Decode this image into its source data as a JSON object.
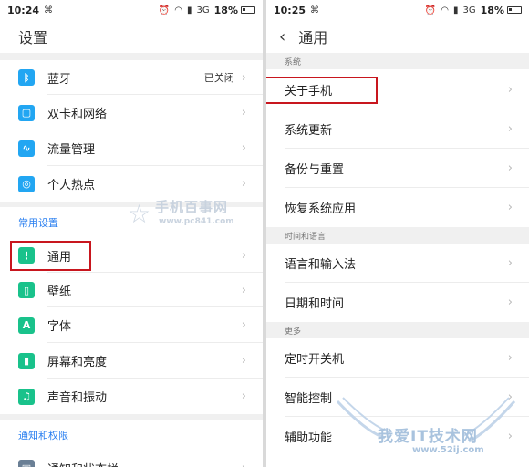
{
  "left": {
    "status": {
      "time": "10:24",
      "network": "3G",
      "battery": "18%"
    },
    "title": "设置",
    "top_items": [
      {
        "icon": "bluetooth-icon",
        "label": "蓝牙",
        "value": "已关闭"
      },
      {
        "icon": "sim-icon",
        "label": "双卡和网络"
      },
      {
        "icon": "data-usage-icon",
        "label": "流量管理"
      },
      {
        "icon": "hotspot-icon",
        "label": "个人热点"
      }
    ],
    "section_common": "常用设置",
    "common_items": [
      {
        "icon": "general-icon",
        "label": "通用"
      },
      {
        "icon": "wallpaper-icon",
        "label": "壁纸"
      },
      {
        "icon": "font-icon",
        "label": "字体"
      },
      {
        "icon": "brightness-icon",
        "label": "屏幕和亮度"
      },
      {
        "icon": "bell-icon",
        "label": "声音和振动"
      }
    ],
    "section_notify": "通知和权限",
    "notify_items": [
      {
        "icon": "notification-icon",
        "label": "通知和状态栏"
      }
    ]
  },
  "right": {
    "status": {
      "time": "10:25",
      "network": "3G",
      "battery": "18%"
    },
    "title": "通用",
    "section_system": "系统",
    "system_items": [
      "关于手机",
      "系统更新",
      "备份与重置",
      "恢复系统应用"
    ],
    "section_lang": "时间和语言",
    "lang_items": [
      "语言和输入法",
      "日期和时间"
    ],
    "section_more": "更多",
    "more_items": [
      "定时开关机",
      "智能控制",
      "辅助功能"
    ]
  },
  "watermarks": {
    "site1_title": "手机百事网",
    "site1_url": "www.pc841.com",
    "site2_title": "我爱IT技术网",
    "site2_url": "www.52ij.com"
  },
  "colors": {
    "accent_blue": "#2a7ff0",
    "icon_blue": "#22a6f2",
    "icon_green": "#19c28b",
    "highlight_red": "#c8161e"
  }
}
